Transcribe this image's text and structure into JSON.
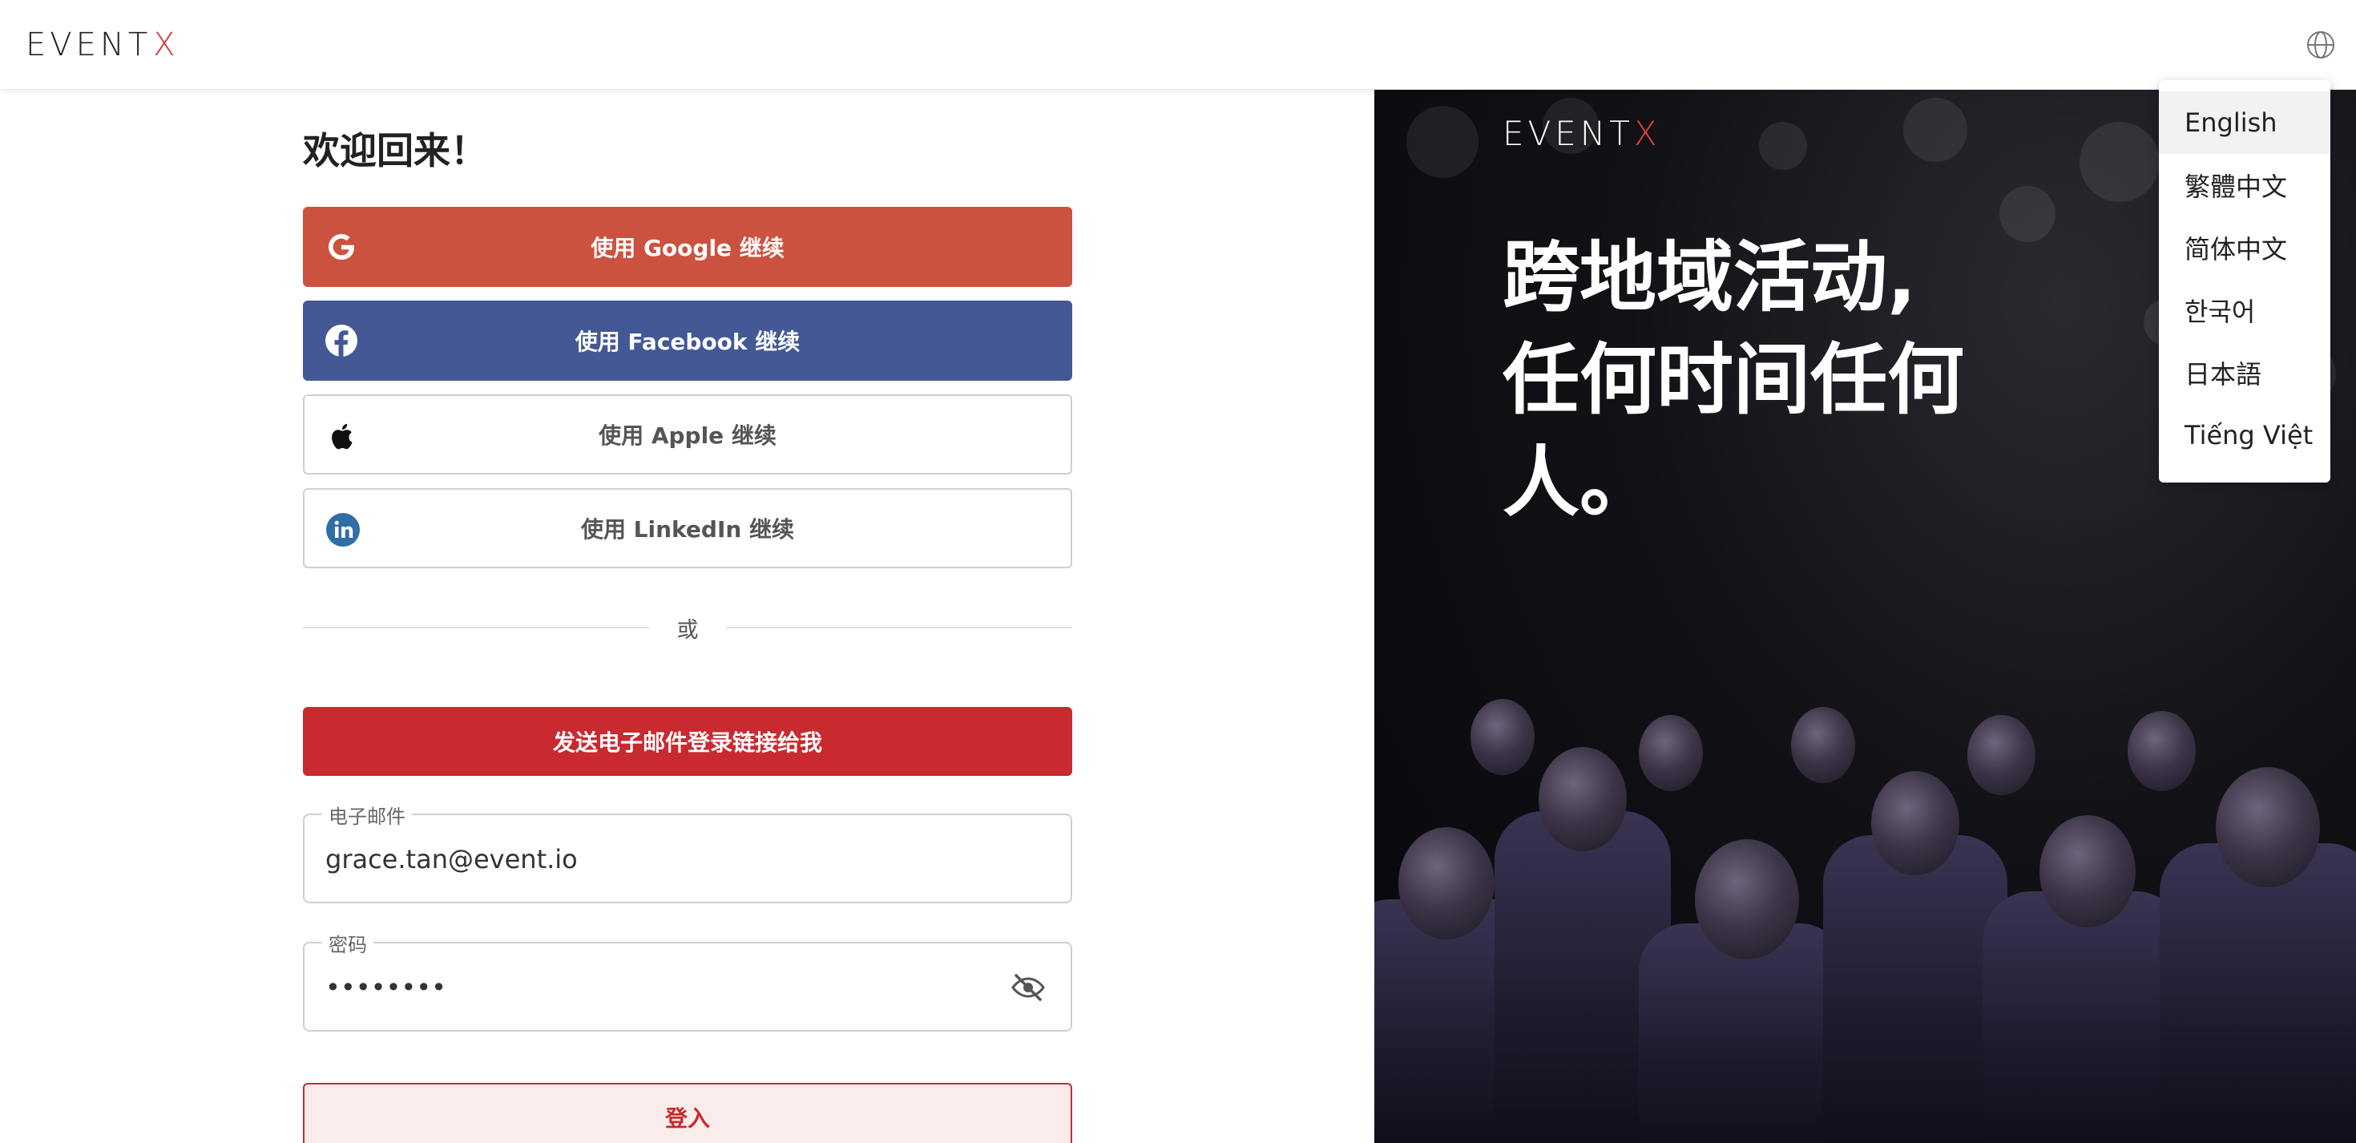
{
  "header": {
    "logo_text": "EVENT",
    "logo_x": "X"
  },
  "login": {
    "welcome": "欢迎回来！",
    "google_label": "使用 Google 继续",
    "facebook_label": "使用 Facebook 继续",
    "apple_label": "使用 Apple 继续",
    "linkedin_label": "使用 LinkedIn 继续",
    "or_label": "或",
    "magic_link_label": "发送电子邮件登录链接给我",
    "email_label": "电子邮件",
    "email_value": "grace.tan@event.io",
    "password_label": "密码",
    "password_value": "••••••••",
    "login_button": "登入"
  },
  "hero": {
    "logo_text": "EVENT",
    "logo_x": "X",
    "tagline": "跨地域活动, 任何时间任何人。"
  },
  "language_menu": {
    "items": [
      "English",
      "繁體中文",
      "简体中文",
      "한국어",
      "日本語",
      "Tiếng Việt"
    ],
    "selected": "English"
  },
  "colors": {
    "google": "#cc5240",
    "facebook": "#435895",
    "primary_red": "#c82a2f",
    "linkedin": "#2f6ea6"
  },
  "icons": {
    "language": "globe-icon",
    "google": "google-icon",
    "facebook": "facebook-icon",
    "apple": "apple-icon",
    "linkedin": "linkedin-icon",
    "password_toggle": "eye-off-icon"
  }
}
